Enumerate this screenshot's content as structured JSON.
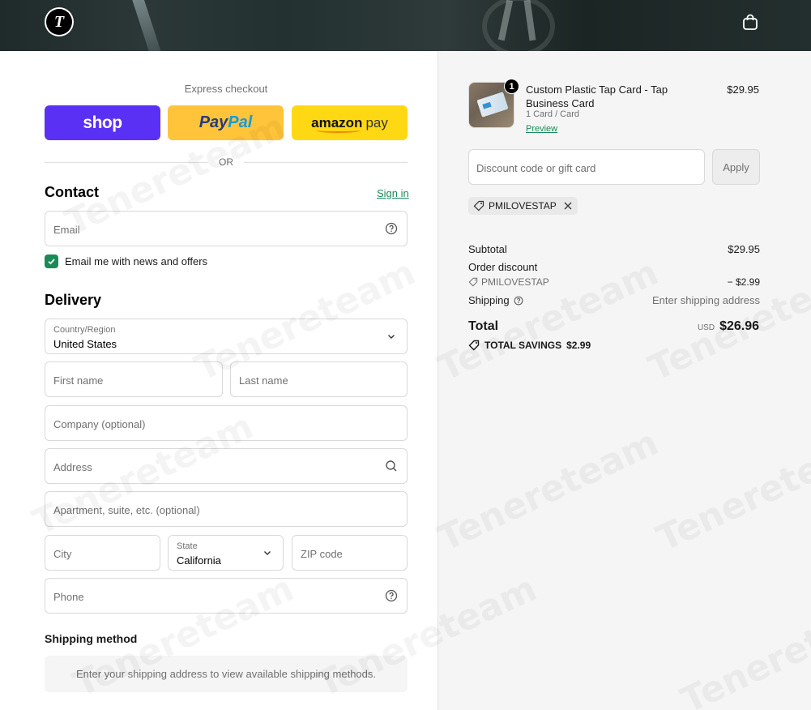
{
  "header": {
    "logo_text": "T",
    "cart_icon": "shopping-bag-icon"
  },
  "express": {
    "title": "Express checkout",
    "shop_label": "shop",
    "paypal_part1": "Pay",
    "paypal_part2": "Pal",
    "amazon_part1": "amazon",
    "amazon_part2": "pay",
    "or_label": "OR"
  },
  "contact": {
    "title": "Contact",
    "signin_label": "Sign in",
    "email_placeholder": "Email",
    "newsletter_label": "Email me with news and offers",
    "newsletter_checked": true
  },
  "delivery": {
    "title": "Delivery",
    "country_label": "Country/Region",
    "country_value": "United States",
    "first_name_placeholder": "First name",
    "last_name_placeholder": "Last name",
    "company_placeholder": "Company (optional)",
    "address_placeholder": "Address",
    "apartment_placeholder": "Apartment, suite, etc. (optional)",
    "city_placeholder": "City",
    "state_label": "State",
    "state_value": "California",
    "zip_placeholder": "ZIP code",
    "phone_placeholder": "Phone"
  },
  "shipping_method": {
    "title": "Shipping method",
    "message": "Enter your shipping address to view available shipping methods."
  },
  "order": {
    "product": {
      "name": "Custom Plastic Tap Card - Tap Business Card",
      "variant": "1 Card / Card",
      "preview_label": "Preview",
      "price": "$29.95",
      "quantity": "1"
    },
    "discount_placeholder": "Discount code or gift card",
    "apply_label": "Apply",
    "applied_code": "PMILOVESTAP",
    "subtotal_label": "Subtotal",
    "subtotal_value": "$29.95",
    "order_discount_label": "Order discount",
    "discount_code": "PMILOVESTAP",
    "discount_value": "− $2.99",
    "shipping_label": "Shipping",
    "shipping_value": "Enter shipping address",
    "total_label": "Total",
    "total_currency": "USD",
    "total_value": "$26.96",
    "savings_label": "TOTAL SAVINGS",
    "savings_value": "$2.99"
  },
  "watermark": "Tenereteam",
  "colors": {
    "accent": "#1a8b57",
    "shop": "#5a31f4",
    "paypal": "#ffc439",
    "amazon": "#ffd814"
  }
}
